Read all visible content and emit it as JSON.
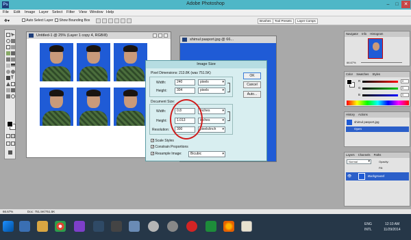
{
  "app": {
    "title": "Adobe Photoshop"
  },
  "menu": [
    "File",
    "Edit",
    "Image",
    "Layer",
    "Select",
    "Filter",
    "View",
    "Window",
    "Help"
  ],
  "options": {
    "auto_select": "Auto Select Layer",
    "bounding": "Show Bounding Box",
    "ws_tabs": [
      "Brushes",
      "Tool Presets",
      "Layer Comps"
    ]
  },
  "doc1": {
    "title": "Untitled-1 @ 25% (Layer 1 copy 4, RGB/8)"
  },
  "doc2": {
    "title": "shimul pasport.jpg @ 66..."
  },
  "dialog": {
    "title": "Image Size",
    "pixel_dimensions": "Pixel Dimensions: 213.8K (was 751.5K)",
    "width_label": "Width:",
    "width_value": "240",
    "width_unit": "pixels",
    "height_label": "Height:",
    "height_value": "304",
    "height_unit": "pixels",
    "doc_size_label": "Document Size:",
    "doc_width_label": "Width:",
    "doc_width_value": "0.8",
    "doc_width_unit": "inches",
    "doc_height_label": "Height:",
    "doc_height_value": "1.013",
    "doc_height_unit": "inches",
    "res_label": "Resolution:",
    "res_value": "300",
    "res_unit": "pixels/inch",
    "scale_styles": "Scale Styles",
    "constrain": "Constrain Proportions",
    "resample": "Resample Image:",
    "resample_value": "Bicubic",
    "ok": "OK",
    "cancel": "Cancel",
    "auto": "Auto..."
  },
  "navigator": {
    "tabs": [
      "Navigator",
      "Info",
      "Histogram"
    ],
    "zoom": "66.67%"
  },
  "color": {
    "tabs": [
      "Color",
      "Swatches",
      "Styles"
    ],
    "channels": [
      "R",
      "G",
      "B"
    ],
    "values": [
      "0",
      "0",
      "0"
    ]
  },
  "history": {
    "tabs": [
      "History",
      "Actions"
    ],
    "items": [
      "shimul pasport.jpg",
      "Open"
    ]
  },
  "layers": {
    "tabs": [
      "Layers",
      "Channels",
      "Paths"
    ],
    "mode": "Normal",
    "opacity": "Opacity:",
    "fill": "Fill:",
    "layer_name": "Background"
  },
  "status": {
    "zoom": "66.67%",
    "doc": "Doc: 751.5K/751.5K"
  },
  "tray": {
    "lang": "ENG",
    "locale": "INTL",
    "time": "12:10 AM",
    "date": "11/29/2014"
  }
}
